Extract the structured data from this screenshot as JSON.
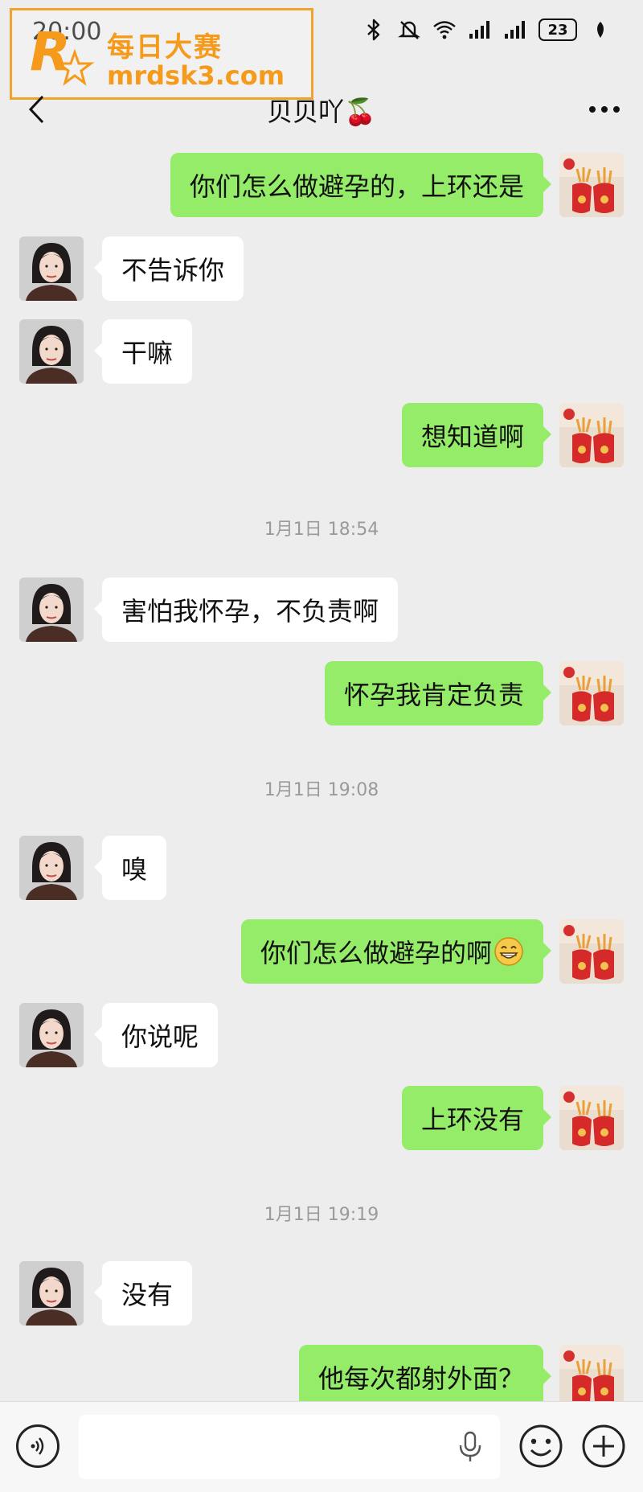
{
  "status_bar": {
    "time": "20:00",
    "battery": "23"
  },
  "watermark": {
    "title": "每日大赛",
    "domain": "mrdsk3.com",
    "logo_letter": "R"
  },
  "header": {
    "title": "贝贝吖🍒"
  },
  "messages": [
    {
      "side": "right",
      "text": "你们怎么做避孕的，上环还是"
    },
    {
      "side": "left",
      "text": "不告诉你"
    },
    {
      "side": "left",
      "text": "干嘛"
    },
    {
      "side": "right",
      "text": "想知道啊"
    },
    {
      "side": "time",
      "text": "1月1日 18:54"
    },
    {
      "side": "left",
      "text": "害怕我怀孕，不负责啊"
    },
    {
      "side": "right",
      "text": "怀孕我肯定负责"
    },
    {
      "side": "time",
      "text": "1月1日 19:08"
    },
    {
      "side": "left",
      "text": "嗅"
    },
    {
      "side": "right",
      "text": "你们怎么做避孕的啊",
      "emoji": "grin-emoji"
    },
    {
      "side": "left",
      "text": "你说呢"
    },
    {
      "side": "right",
      "text": "上环没有"
    },
    {
      "side": "time",
      "text": "1月1日 19:19"
    },
    {
      "side": "left",
      "text": "没有"
    },
    {
      "side": "right",
      "text": "他每次都射外面？"
    }
  ],
  "colors": {
    "self_bubble": "#95ec69",
    "other_bubble": "#ffffff",
    "background": "#ededed",
    "watermark": "#f59a1b"
  },
  "icons": [
    "back-icon",
    "more-icon",
    "bluetooth-icon",
    "mute-icon",
    "wifi-icon",
    "signal-icon",
    "voice-icon",
    "mic-icon",
    "emoji-icon",
    "plus-icon"
  ]
}
